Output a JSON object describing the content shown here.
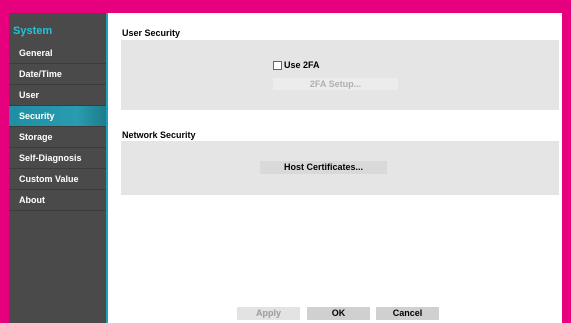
{
  "sidebar": {
    "title": "System",
    "items": [
      {
        "label": "General"
      },
      {
        "label": "Date/Time"
      },
      {
        "label": "User"
      },
      {
        "label": "Security"
      },
      {
        "label": "Storage"
      },
      {
        "label": "Self-Diagnosis"
      },
      {
        "label": "Custom Value"
      },
      {
        "label": "About"
      }
    ],
    "active_item": "Security"
  },
  "user_security": {
    "title": "User Security",
    "use_2fa_label": "Use 2FA",
    "use_2fa_checked": false,
    "setup_button": "2FA Setup..."
  },
  "network_security": {
    "title": "Network Security",
    "certificates_button": "Host Certificates..."
  },
  "footer": {
    "apply": "Apply",
    "ok": "OK",
    "cancel": "Cancel"
  },
  "colors": {
    "frame": "#e6007e",
    "accent": "#1ea1b7",
    "sidebar_bg": "#4a4a4a"
  }
}
